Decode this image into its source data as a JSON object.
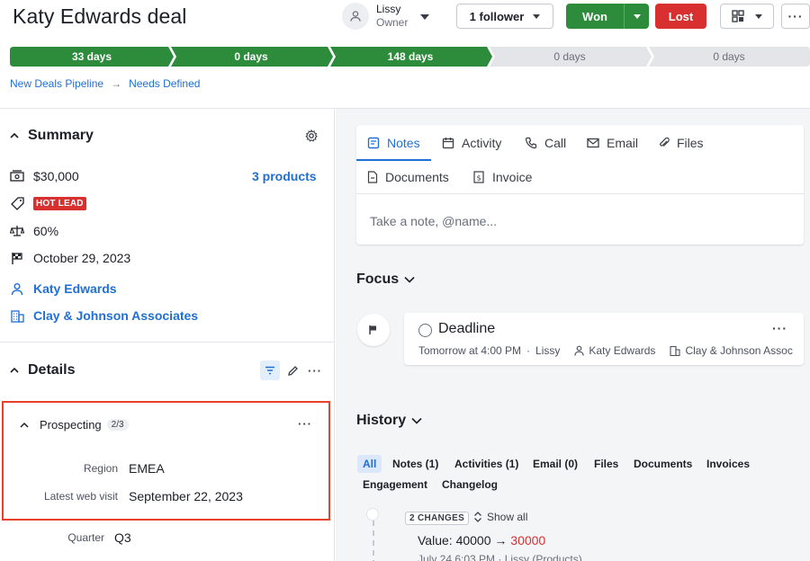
{
  "header": {
    "title": "Katy Edwards deal",
    "owner_name": "Lissy",
    "owner_role": "Owner",
    "follower_label": "1 follower",
    "won_label": "Won",
    "lost_label": "Lost",
    "more_label": "···"
  },
  "stages": [
    {
      "label": "33 days",
      "done": true
    },
    {
      "label": "0 days",
      "done": true
    },
    {
      "label": "148 days",
      "done": true
    },
    {
      "label": "0 days",
      "done": false
    },
    {
      "label": "0 days",
      "done": false
    }
  ],
  "breadcrumb": {
    "pipeline": "New Deals Pipeline",
    "sep": "→",
    "stage": "Needs Defined"
  },
  "summary": {
    "title": "Summary",
    "value": "$30,000",
    "products": "3 products",
    "label_badge": "HOT LEAD",
    "probability": "60%",
    "close_date": "October 29, 2023",
    "person": "Katy Edwards",
    "organization": "Clay & Johnson Associates"
  },
  "details": {
    "title": "Details",
    "more": "···",
    "group": {
      "title": "Prospecting",
      "count": "2/3",
      "more": "···",
      "fields": [
        {
          "label": "Region",
          "value": "EMEA"
        },
        {
          "label": "Latest web visit",
          "value": "September 22, 2023"
        }
      ]
    },
    "extra_field": {
      "label": "Quarter",
      "value": "Q3"
    }
  },
  "composer": {
    "tabs": [
      "Notes",
      "Activity",
      "Call",
      "Email",
      "Files",
      "Documents",
      "Invoice"
    ],
    "placeholder": "Take a note, @name..."
  },
  "focus": {
    "title": "Focus",
    "activity": {
      "title": "Deadline",
      "when": "Tomorrow at 4:00 PM",
      "sep": "·",
      "owner": "Lissy",
      "person": "Katy Edwards",
      "org": "Clay & Johnson Assoc",
      "more": "···"
    }
  },
  "history": {
    "title": "History",
    "filters": [
      "All",
      "Notes (1)",
      "Activities (1)",
      "Email (0)",
      "Files",
      "Documents",
      "Invoices",
      "Engagement",
      "Changelog"
    ],
    "changes_badge": "2 CHANGES",
    "show_all": "Show all",
    "change_field": "Value",
    "change_colon": ":",
    "change_old": "40000",
    "change_arrow": "→",
    "change_new": "30000",
    "change_meta": "July 24 6:03 PM · Lissy (Products)"
  },
  "colors": {
    "accent": "#1f6fd6",
    "won": "#2d8b3c",
    "lost": "#d7302f",
    "stage_done": "#2d8b3c",
    "stage_todo": "#e4e5e8",
    "highlight": "#e8402a"
  }
}
